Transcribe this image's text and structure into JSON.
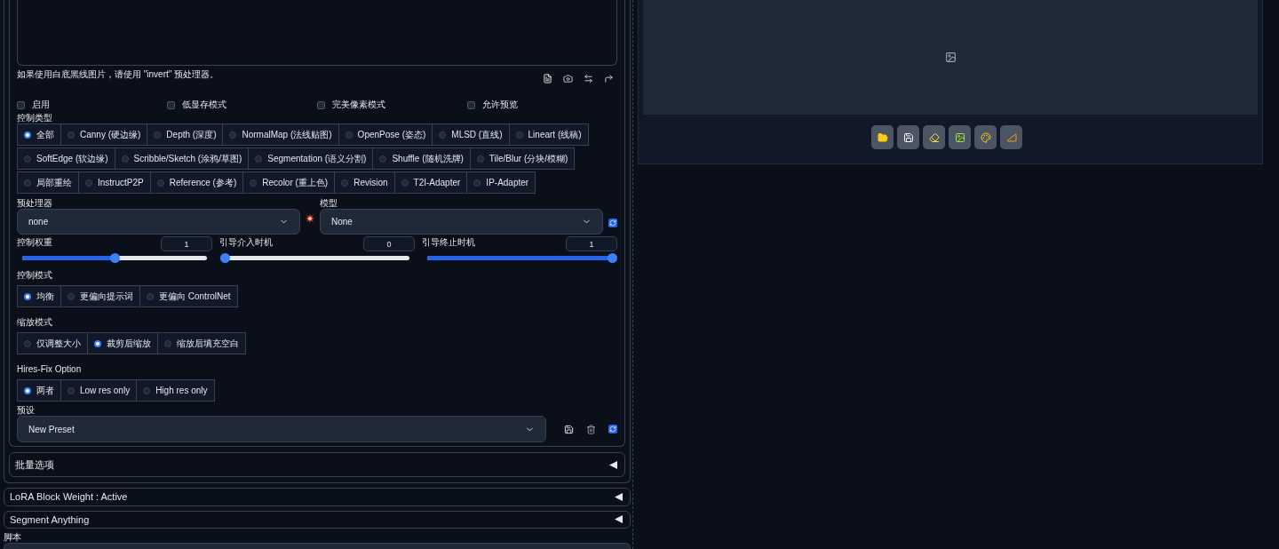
{
  "controlnet": {
    "upload_hint": "如果使用白底黑线图片，请使用 \"invert\" 预处理器。",
    "options": [
      {
        "label": "启用",
        "checked": false
      },
      {
        "label": "低显存模式",
        "checked": false
      },
      {
        "label": "完美像素模式",
        "checked": false
      },
      {
        "label": "允许预览",
        "checked": false
      }
    ],
    "control_type": {
      "label": "控制类型",
      "options": [
        {
          "label": "全部",
          "selected": true
        },
        {
          "label": "Canny (硬边缘)",
          "selected": false
        },
        {
          "label": "Depth (深度)",
          "selected": false
        },
        {
          "label": "NormalMap (法线贴图)",
          "selected": false
        },
        {
          "label": "OpenPose (姿态)",
          "selected": false
        },
        {
          "label": "MLSD (直线)",
          "selected": false
        },
        {
          "label": "Lineart (线稿)",
          "selected": false
        },
        {
          "label": "SoftEdge (软边缘)",
          "selected": false
        },
        {
          "label": "Scribble/Sketch (涂鸦/草图)",
          "selected": false
        },
        {
          "label": "Segmentation (语义分割)",
          "selected": false
        },
        {
          "label": "Shuffle (随机洗牌)",
          "selected": false
        },
        {
          "label": "Tile/Blur (分块/模糊)",
          "selected": false
        },
        {
          "label": "局部重绘",
          "selected": false
        },
        {
          "label": "InstructP2P",
          "selected": false
        },
        {
          "label": "Reference (参考)",
          "selected": false
        },
        {
          "label": "Recolor (重上色)",
          "selected": false
        },
        {
          "label": "Revision",
          "selected": false
        },
        {
          "label": "T2I-Adapter",
          "selected": false
        },
        {
          "label": "IP-Adapter",
          "selected": false
        }
      ]
    },
    "preprocessor": {
      "label": "预处理器",
      "value": "none"
    },
    "model": {
      "label": "模型",
      "value": "None"
    },
    "sliders": [
      {
        "label": "控制权重",
        "value": "1",
        "level": 0.5
      },
      {
        "label": "引导介入时机",
        "value": "0",
        "level": 0
      },
      {
        "label": "引导终止时机",
        "value": "1",
        "level": 1
      }
    ],
    "radio_groups": [
      {
        "label": "控制模式",
        "options": [
          {
            "label": "均衡",
            "selected": true
          },
          {
            "label": "更偏向提示词",
            "selected": false
          },
          {
            "label": "更偏向 ControlNet",
            "selected": false
          }
        ]
      },
      {
        "label": "缩放模式",
        "options": [
          {
            "label": "仅调整大小",
            "selected": false
          },
          {
            "label": "裁剪后缩放",
            "selected": true
          },
          {
            "label": "缩放后填充空白",
            "selected": false
          }
        ]
      },
      {
        "label": "Hires-Fix Option",
        "options": [
          {
            "label": "两者",
            "selected": true
          },
          {
            "label": "Low res only",
            "selected": false
          },
          {
            "label": "High res only",
            "selected": false
          }
        ]
      }
    ],
    "preset": {
      "label": "预设",
      "value": "New Preset"
    }
  },
  "batch_accordion": {
    "title": "批量选项"
  },
  "accordions": [
    {
      "title": "LoRA Block Weight : Active"
    },
    {
      "title": "Segment Anything"
    }
  ],
  "script_label": "脚本"
}
